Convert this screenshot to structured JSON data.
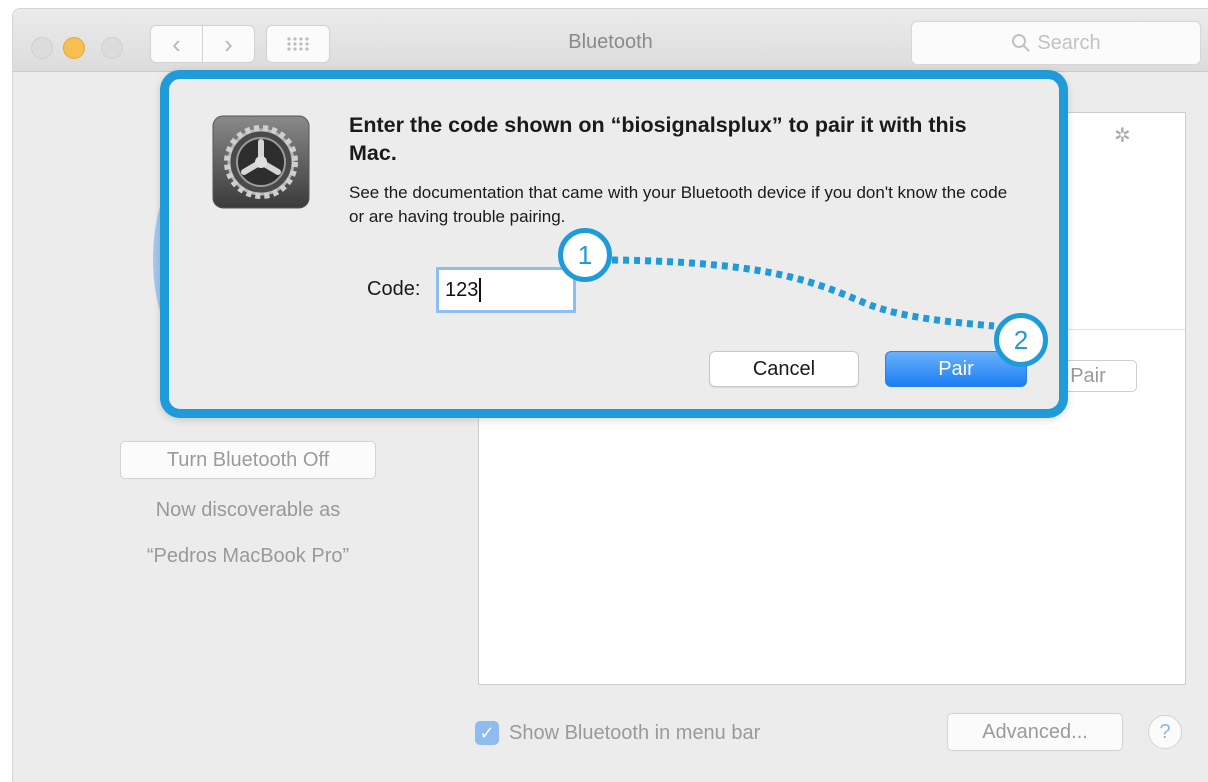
{
  "window": {
    "title": "Bluetooth",
    "search_placeholder": "Search",
    "nav_back": "‹",
    "nav_forward": "›"
  },
  "sidebar": {
    "toggle_button": "Turn Bluetooth Off",
    "discoverable_line1": "Now discoverable as",
    "discoverable_line2": "“Pedros MacBook Pro”"
  },
  "devices": {
    "background_pair_label": "Pair"
  },
  "footer": {
    "show_in_menu_bar": "Show Bluetooth in menu bar",
    "show_in_menu_bar_checked": true,
    "advanced_button": "Advanced...",
    "help_button": "?"
  },
  "dialog": {
    "heading": "Enter the code shown on “biosignalsplux” to pair it with this Mac.",
    "body": "See the documentation that came with your Bluetooth device if you don't know the code or are having trouble pairing.",
    "code_label": "Code:",
    "code_value": "123",
    "cancel_button": "Cancel",
    "pair_button": "Pair"
  },
  "annotations": {
    "step_1": "1",
    "step_2": "2",
    "color": "#1f9bd9"
  },
  "colors": {
    "accent": "#1f9bd9",
    "primary_button": "#1a7ef3",
    "traffic_minimize": "#f6bf4f",
    "bluetooth_hero": "#a5c8ee"
  }
}
